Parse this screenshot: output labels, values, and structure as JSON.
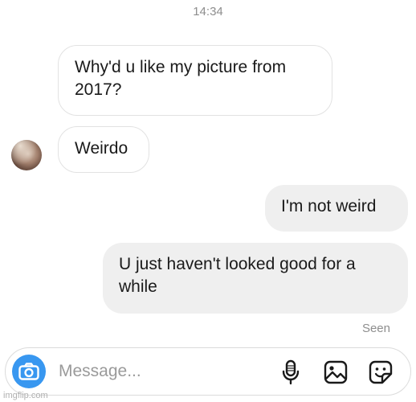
{
  "header": {
    "timestamp": "14:34"
  },
  "messages": [
    {
      "direction": "incoming",
      "text": "Why'd u like my picture from 2017?"
    },
    {
      "direction": "incoming",
      "text": "Weirdo"
    },
    {
      "direction": "outgoing",
      "text": "I'm not weird"
    },
    {
      "direction": "outgoing",
      "text": "U just haven't looked good for a while"
    }
  ],
  "status": {
    "seen": "Seen"
  },
  "composer": {
    "placeholder": "Message...",
    "icons": [
      "camera-icon",
      "microphone-icon",
      "gallery-icon",
      "sticker-icon"
    ],
    "accent_color": "#3897f0"
  },
  "watermark": "imgflip.com",
  "colors": {
    "incoming_bubble": "#ffffff",
    "outgoing_bubble": "#efefef",
    "meta_text": "#8e8e8e"
  }
}
